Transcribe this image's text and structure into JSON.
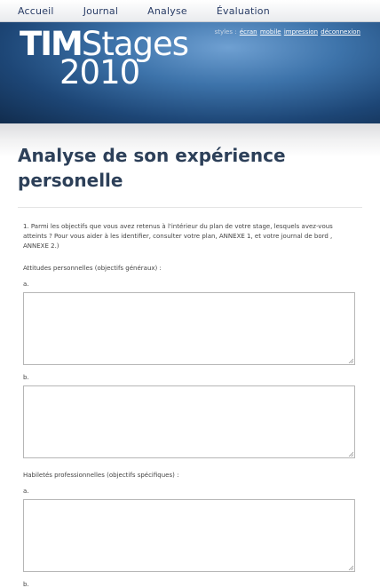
{
  "nav": {
    "items": [
      "Accueil",
      "Journal",
      "Analyse",
      "Évaluation"
    ]
  },
  "banner": {
    "logo_line1_part1": "TIM",
    "logo_line1_part2": "Stages",
    "logo_line2": "2010",
    "styles_label": "styles :",
    "style_links": [
      "écran",
      "mobile",
      "impression",
      "déconnexion"
    ]
  },
  "page": {
    "title": "Analyse de son expérience personelle"
  },
  "form": {
    "question1": "1. Parmi les objectifs que vous avez retenus à l'intérieur du plan de votre stage, lesquels avez-vous atteints ? Pour vous aider à les identifier, consulter votre plan, ANNEXE 1, et votre journal de bord , ANNEXE 2.)",
    "section1_title": "Attitudes personnelles (objectifs généraux) :",
    "section2_title": "Habiletés professionnelles (objectifs spécifiques) :",
    "label_a": "a.",
    "label_b": "b."
  }
}
